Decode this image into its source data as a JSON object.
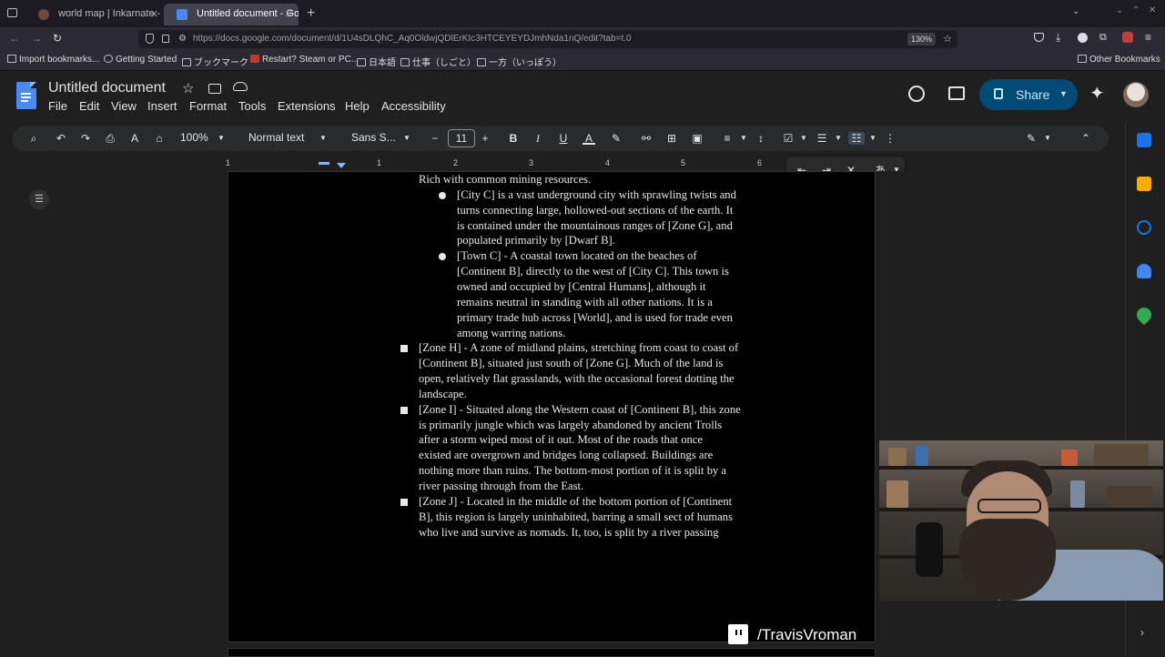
{
  "browser": {
    "tabs": [
      {
        "title": "world map | Inkarnate - C",
        "active": false
      },
      {
        "title": "Untitled document - Goog",
        "active": true
      }
    ],
    "url": "https://docs.google.com/document/d/1U4sDLQhC_Aq0OldwjQDlErKIc3HTCEYEYDJmhNda1nQ/edit?tab=t.0",
    "zoom": "130%",
    "bookmarks": [
      "Import bookmarks...",
      "Getting Started",
      "ブックマーク",
      "Restart? Steam or PC...",
      "日本語",
      "仕事（しごと）",
      "一方（いっぽう）",
      "Other Bookmarks"
    ]
  },
  "doc": {
    "title": "Untitled document",
    "menu": [
      "File",
      "Edit",
      "View",
      "Insert",
      "Format",
      "Tools",
      "Extensions",
      "Help",
      "Accessibility"
    ],
    "share_label": "Share",
    "toolbar": {
      "zoom": "100%",
      "style": "Normal text",
      "font": "Sans S...",
      "font_size": "11"
    },
    "ruler_numbers": [
      "1",
      "1",
      "2",
      "3",
      "4",
      "5",
      "6"
    ],
    "overflow_glyph": "あ"
  },
  "content": {
    "lines": [
      {
        "text": "Rich with common mining resources.",
        "bullet": null
      },
      {
        "text": "[City C] is a vast underground city with sprawling twists and",
        "bullet": "disc"
      },
      {
        "text": "turns connecting large, hollowed-out sections of the earth. It",
        "bullet": null
      },
      {
        "text": "is contained under the mountainous ranges of [Zone G], and",
        "bullet": null
      },
      {
        "text": "populated primarily by [Dwarf B].",
        "bullet": null
      },
      {
        "text": "[Town C] - A coastal town located on the beaches of",
        "bullet": "disc"
      },
      {
        "text": "[Continent B], directly to the west of [City C]. This town is",
        "bullet": null
      },
      {
        "text": "owned and occupied by [Central Humans], although it",
        "bullet": null
      },
      {
        "text": "remains neutral in standing with all other nations. It is a",
        "bullet": null
      },
      {
        "text": "primary trade hub across [World], and is used for trade even",
        "bullet": null
      },
      {
        "text": "among warring nations.",
        "bullet": null
      },
      {
        "text": "[Zone H] - A zone of midland plains, stretching from coast to coast of",
        "bullet": "square"
      },
      {
        "text": "[Continent B], situated just south of [Zone G]. Much of the land is",
        "bullet": null
      },
      {
        "text": "open, relatively flat grasslands, with the occasional forest dotting the",
        "bullet": null
      },
      {
        "text": "landscape.",
        "bullet": null
      },
      {
        "text": "[Zone I] - Situated along the Western coast of [Continent B], this zone",
        "bullet": "square"
      },
      {
        "text": "is primarily jungle which was largely abandoned by ancient Trolls",
        "bullet": null
      },
      {
        "text": "after a storm wiped most of it out. Most of the roads that once",
        "bullet": null
      },
      {
        "text": "existed are overgrown and bridges long collapsed. Buildings are",
        "bullet": null
      },
      {
        "text": "nothing more than ruins. The bottom-most portion of it is split by a",
        "bullet": null
      },
      {
        "text": "river passing through from the East.",
        "bullet": null
      },
      {
        "text": "[Zone J] - Located in the middle of the bottom portion of [Continent",
        "bullet": "square"
      },
      {
        "text": "B], this region is largely uninhabited, barring a small sect of humans",
        "bullet": null
      },
      {
        "text": "who live and survive as nomads. It, too, is split by a river passing",
        "bullet": null
      }
    ]
  },
  "stream": {
    "channel": "/TravisVroman"
  },
  "colors": {
    "share_bg": "#004a77",
    "docs_blue": "#4a8af4",
    "page_bg": "#000000"
  }
}
